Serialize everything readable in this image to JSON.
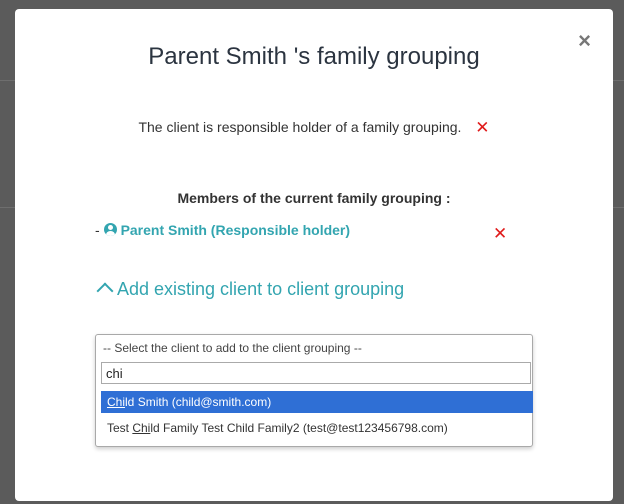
{
  "modal": {
    "title": "Parent Smith 's family grouping",
    "close_icon": "×",
    "info_text": "The client is responsible holder of a family grouping.",
    "remove_icon": "✕",
    "members_heading": "Members of the current family grouping :",
    "member_prefix": "- ",
    "members": [
      {
        "name": "Parent Smith (Responsible holder)"
      }
    ],
    "add_toggle_label": "Add existing client to client grouping",
    "select": {
      "selected_text": "-- Select the client to add to the client grouping --",
      "search_value": "chi",
      "options": [
        {
          "pre": "",
          "match": "Chi",
          "post": "ld Smith (child@smith.com)",
          "highlighted": true
        },
        {
          "pre": "Test ",
          "match": "Chi",
          "post": "ld Family Test Child Family2 (test@test123456798.com)",
          "highlighted": false
        }
      ]
    }
  },
  "colors": {
    "accent": "#33a5b0",
    "danger": "#e01b1b",
    "highlight": "#2f6fd5"
  }
}
